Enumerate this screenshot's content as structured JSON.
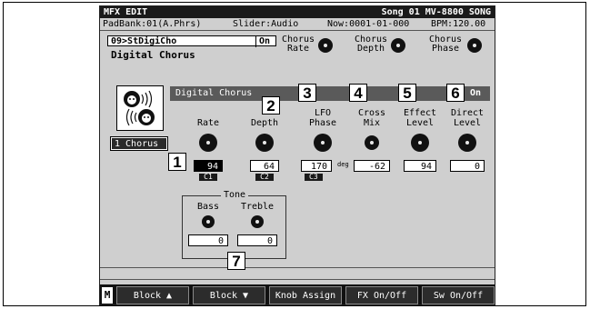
{
  "window": {
    "title": "MFX EDIT",
    "song": "Song 01 MV-8800 SONG"
  },
  "status": {
    "padbank": "PadBank:01(A.Phrs)",
    "slider": "Slider:Audio",
    "now": "Now:0001-01-000",
    "bpm": "BPM:120.00"
  },
  "patch": {
    "number_name": "09>StDigiCho",
    "switch": "On",
    "name": "Digital Chorus"
  },
  "top_knobs": [
    {
      "label": "Chorus\nRate"
    },
    {
      "label": "Chorus\nDepth"
    },
    {
      "label": "Chorus\nPhase"
    }
  ],
  "block_button": "1 Chorus",
  "panel": {
    "title": "Digital Chorus",
    "switch": "On"
  },
  "params": [
    {
      "label": "Rate",
      "value": "94",
      "unit": "",
      "tag": "C1",
      "selected": true
    },
    {
      "label": "Depth",
      "value": "64",
      "unit": "",
      "tag": "C2",
      "selected": false
    },
    {
      "label": "LFO\nPhase",
      "value": "170",
      "unit": "deg",
      "tag": "C3",
      "selected": false
    },
    {
      "label": "Cross\nMix",
      "value": "-62",
      "unit": "",
      "tag": "",
      "selected": false
    },
    {
      "label": "Effect\nLevel",
      "value": "94",
      "unit": "",
      "tag": "",
      "selected": false
    },
    {
      "label": "Direct\nLevel",
      "value": "0",
      "unit": "",
      "tag": "",
      "selected": false
    }
  ],
  "tone": {
    "title": "Tone",
    "bass_label": "Bass",
    "bass_value": "0",
    "treble_label": "Treble",
    "treble_value": "0"
  },
  "callouts": [
    "1",
    "2",
    "3",
    "4",
    "5",
    "6",
    "7"
  ],
  "function_bar": {
    "m_label": "M",
    "buttons": [
      {
        "label": "Block ▲"
      },
      {
        "label": "Block ▼"
      },
      {
        "label": "Knob Assign"
      },
      {
        "label": "FX On/Off"
      },
      {
        "label": "Sw On/Off"
      }
    ]
  }
}
